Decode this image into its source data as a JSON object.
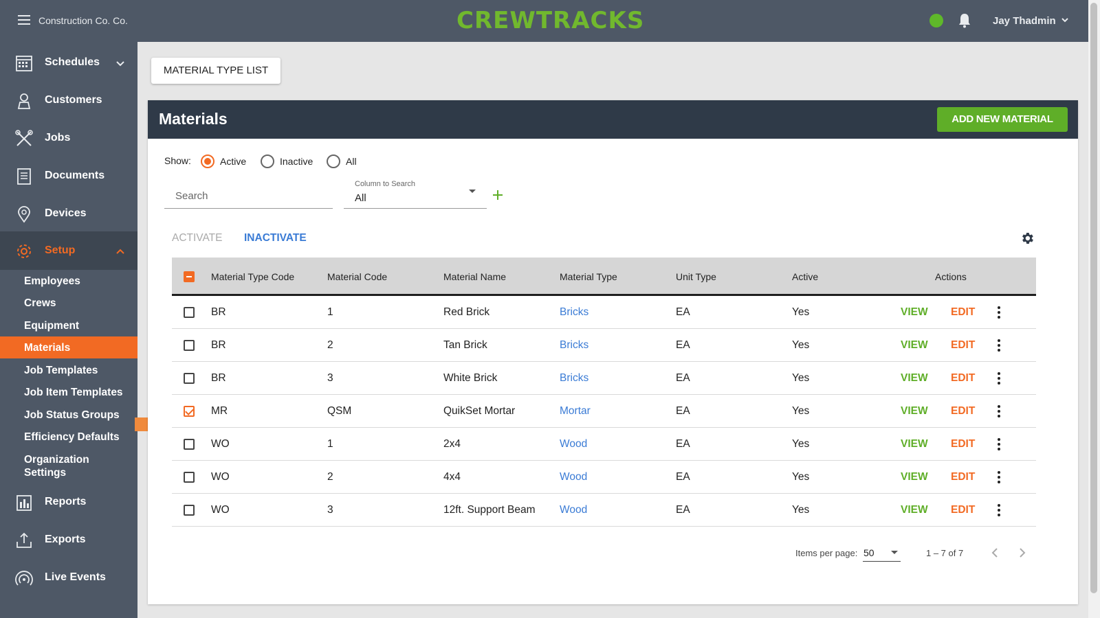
{
  "header": {
    "company": "Construction Co. Co.",
    "logo": "CREWTRACKS",
    "user": "Jay Thadmin",
    "status_color": "#5fb82a"
  },
  "sidebar": {
    "items": [
      {
        "label": "Schedules",
        "icon": "calendar-icon"
      },
      {
        "label": "Customers",
        "icon": "customer-icon"
      },
      {
        "label": "Jobs",
        "icon": "tools-icon"
      },
      {
        "label": "Documents",
        "icon": "documents-icon"
      },
      {
        "label": "Devices",
        "icon": "location-pin-icon"
      },
      {
        "label": "Setup",
        "icon": "gear-icon"
      }
    ],
    "setup_sub": [
      {
        "label": "Employees"
      },
      {
        "label": "Crews"
      },
      {
        "label": "Equipment"
      },
      {
        "label": "Materials"
      },
      {
        "label": "Job Templates"
      },
      {
        "label": "Job Item Templates"
      },
      {
        "label": "Job Status Groups"
      },
      {
        "label": "Efficiency Defaults"
      },
      {
        "label": "Organization Settings"
      }
    ],
    "bottom_items": [
      {
        "label": "Reports",
        "icon": "bar-chart-icon"
      },
      {
        "label": "Exports",
        "icon": "export-icon"
      },
      {
        "label": "Live Events",
        "icon": "broadcast-icon"
      }
    ]
  },
  "main": {
    "type_list_button": "MATERIAL TYPE LIST",
    "title": "Materials",
    "add_button": "ADD NEW MATERIAL",
    "show_label": "Show:",
    "filters": [
      "Active",
      "Inactive",
      "All"
    ],
    "filter_selected": "Active",
    "search_placeholder": "Search",
    "column_label": "Column to Search",
    "column_value": "All",
    "activate": "ACTIVATE",
    "inactivate": "INACTIVATE"
  },
  "table": {
    "columns": [
      "Material Type Code",
      "Material Code",
      "Material Name",
      "Material Type",
      "Unit Type",
      "Active",
      "Actions"
    ],
    "rows": [
      {
        "type_code": "BR",
        "code": "1",
        "name": "Red Brick",
        "type": "Bricks",
        "unit": "EA",
        "active": "Yes",
        "checked": false
      },
      {
        "type_code": "BR",
        "code": "2",
        "name": "Tan Brick",
        "type": "Bricks",
        "unit": "EA",
        "active": "Yes",
        "checked": false
      },
      {
        "type_code": "BR",
        "code": "3",
        "name": "White Brick",
        "type": "Bricks",
        "unit": "EA",
        "active": "Yes",
        "checked": false
      },
      {
        "type_code": "MR",
        "code": "QSM",
        "name": "QuikSet Mortar",
        "type": "Mortar",
        "unit": "EA",
        "active": "Yes",
        "checked": true
      },
      {
        "type_code": "WO",
        "code": "1",
        "name": "2x4",
        "type": "Wood",
        "unit": "EA",
        "active": "Yes",
        "checked": false
      },
      {
        "type_code": "WO",
        "code": "2",
        "name": "4x4",
        "type": "Wood",
        "unit": "EA",
        "active": "Yes",
        "checked": false
      },
      {
        "type_code": "WO",
        "code": "3",
        "name": "12ft. Support Beam",
        "type": "Wood",
        "unit": "EA",
        "active": "Yes",
        "checked": false
      }
    ],
    "view_label": "VIEW",
    "edit_label": "EDIT"
  },
  "pagination": {
    "items_per_page_label": "Items per page:",
    "items_per_page": "50",
    "range": "1 – 7 of 7"
  },
  "colors": {
    "accent": "#f26a23",
    "brand_green": "#5fae28",
    "sidebar": "#4e5866",
    "header_dark": "#2f3a48",
    "link": "#3a7bd5"
  }
}
